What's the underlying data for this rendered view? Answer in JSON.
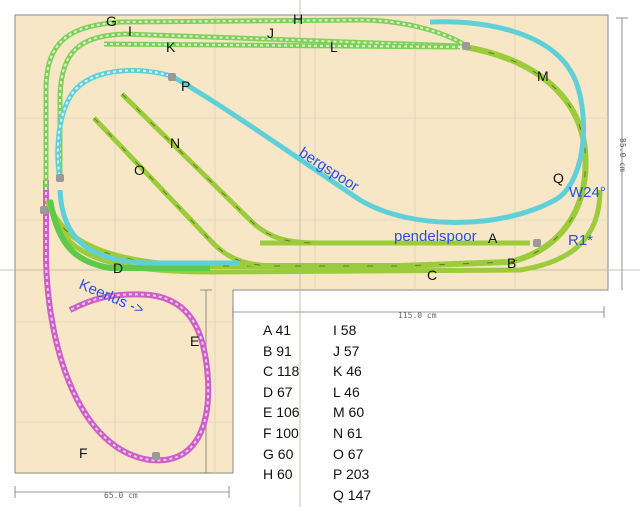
{
  "colors": {
    "board": "#f8e7c6",
    "grid": "#d9d3c8",
    "track_green": "#9ccc3c",
    "track_green_dark": "#5aa33a",
    "track_blue": "#5fd0d8",
    "track_magenta": "#cc5fc8",
    "label_blue": "#2b4fe0"
  },
  "labels": {
    "bergspoor": "bergspoor",
    "pendelspoor": "pendelspoor",
    "keerlus": "Keerlus ->",
    "w24": "W24°",
    "r1": "R1*"
  },
  "dimensions": {
    "width_top": "115.0 cm",
    "width_bottom": "65.0 cm",
    "height_right": "85.0 cm"
  },
  "track_letters": [
    "A",
    "B",
    "C",
    "D",
    "E",
    "F",
    "G",
    "H",
    "I",
    "J",
    "K",
    "L",
    "M",
    "N",
    "O",
    "P",
    "Q"
  ],
  "legend_left": [
    "A 41",
    "B 91",
    "C 118",
    "D 67",
    "E 106",
    "F 100",
    "G 60",
    "H 60"
  ],
  "legend_right": [
    "I 58",
    "J 57",
    "K 46",
    "L 46",
    "M 60",
    "N 61",
    "O 67",
    "P 203",
    "Q 147"
  ]
}
